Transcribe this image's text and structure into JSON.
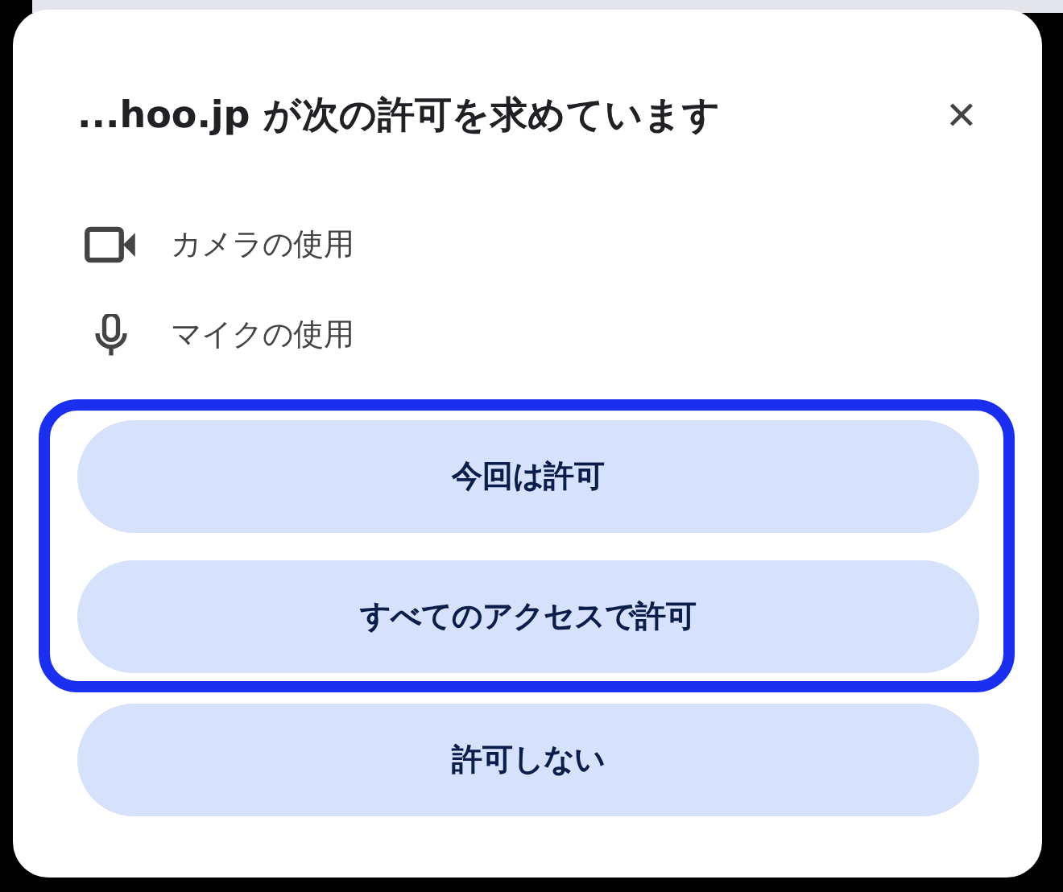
{
  "dialog": {
    "title": "...hoo.jp が次の許可を求めています",
    "close": "✕"
  },
  "permissions": [
    {
      "kind": "camera",
      "label": "カメラの使用"
    },
    {
      "kind": "microphone",
      "label": "マイクの使用"
    }
  ],
  "buttons": [
    {
      "label": "今回は許可",
      "highlighted": true
    },
    {
      "label": "すべてのアクセスで許可",
      "highlighted": true
    },
    {
      "label": "許可しない",
      "highlighted": false
    }
  ]
}
